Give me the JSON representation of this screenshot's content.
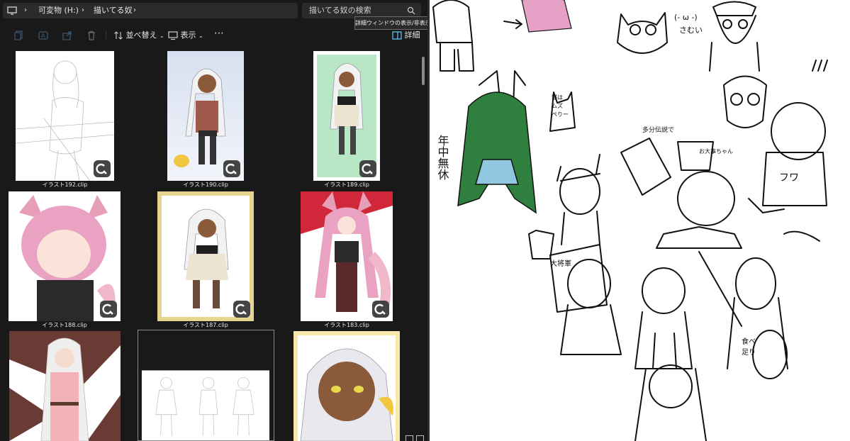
{
  "explorer": {
    "breadcrumb": [
      "可変物 (H:)",
      "描いてる奴"
    ],
    "search_placeholder": "描いてる奴の検索",
    "toolbar": {
      "sort_label": "並べ替え",
      "view_label": "表示",
      "details_label": "詳細"
    },
    "tooltip": "詳細ウィンドウの表示/非表示を切り替えます。",
    "files": [
      {
        "name": "イラスト192.clip"
      },
      {
        "name": "イラスト190.clip"
      },
      {
        "name": "イラスト189.clip"
      },
      {
        "name": "イラスト188.clip"
      },
      {
        "name": "イラスト187.clip"
      },
      {
        "name": "イラスト183.clip"
      },
      {
        "name": ""
      },
      {
        "name": ""
      },
      {
        "name": ""
      }
    ]
  },
  "canvas": {
    "notes": [
      "年中無休",
      "(- ω -)",
      "さむい",
      "多分伝説で",
      "お大事ちゃん",
      "大将軍",
      "フワ",
      "猫は",
      "ムズ",
      "ぺりー",
      "食べ",
      "足り"
    ]
  },
  "colors": {
    "explorer_bg": "#191919",
    "accent": "#60cdff",
    "canvas_bg": "#ffffff"
  }
}
